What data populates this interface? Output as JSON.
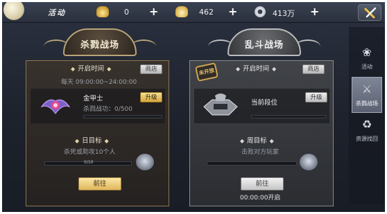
{
  "topbar": {
    "title": "活动",
    "currencies": [
      {
        "icon": "gold-ingot-icon",
        "value": "0",
        "plus": "+"
      },
      {
        "icon": "silver-ingot-icon",
        "value": "462",
        "plus": "+"
      },
      {
        "icon": "coin-icon",
        "value": "413万",
        "plus": "+"
      }
    ]
  },
  "sidebar": {
    "tabs": [
      {
        "label": "活动",
        "icon": "flower-icon",
        "active": false
      },
      {
        "label": "杀戮战场",
        "icon": "swords-icon",
        "active": true
      },
      {
        "label": "资源找回",
        "icon": "recycle-icon",
        "active": false
      }
    ]
  },
  "left_panel": {
    "banner": "杀戮战场",
    "open_time_heading": "开启时间",
    "shop": "商店",
    "schedule": "每天 09:00:00~24:00:00",
    "rank_name": "金甲士",
    "upgrade": "升级",
    "battle_power": "杀戮战功：0/500",
    "daily_goal_heading": "日目标",
    "daily_goal": "杀死或助攻10个人",
    "progress_text": "0/10",
    "progress_fraction": 0.0,
    "go": "前往"
  },
  "right_panel": {
    "banner": "乱斗战场",
    "stamp": "未开放",
    "open_time_heading": "开启时间",
    "shop": "商店",
    "current_rank": "当前段位",
    "upgrade": "升级",
    "weekly_goal_heading": "周目标",
    "weekly_goal": "击败对方玩家",
    "go": "前往",
    "open_time": "00:00:00开启"
  },
  "colors": {
    "gold_button": "#e0b65a",
    "gold_frame": "#8c7650",
    "gray_frame": "#8a8a8a"
  }
}
